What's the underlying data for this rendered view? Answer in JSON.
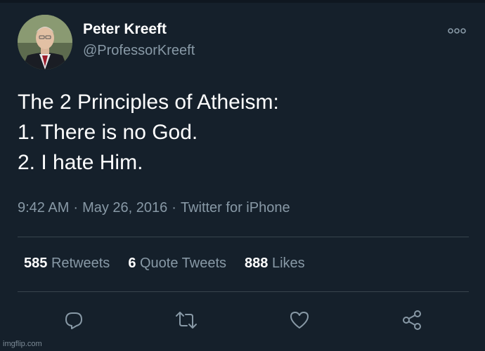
{
  "author": {
    "name": "Peter Kreeft",
    "handle": "@ProfessorKreeft"
  },
  "tweet": {
    "lines": [
      "The 2 Principles of Atheism:",
      "1. There is no God.",
      "2. I hate Him."
    ]
  },
  "meta": {
    "time": "9:42 AM",
    "separator": "·",
    "date": "May 26, 2016",
    "source": "Twitter for iPhone"
  },
  "stats": {
    "retweets_count": "585",
    "retweets_label": "Retweets",
    "quotes_count": "6",
    "quotes_label": "Quote Tweets",
    "likes_count": "888",
    "likes_label": "Likes"
  },
  "actions": [
    "reply-icon",
    "retweet-icon",
    "like-icon",
    "share-icon"
  ],
  "watermark": "imgflip.com",
  "colors": {
    "background": "#15202b",
    "text": "#ffffff",
    "secondary": "#8899a6",
    "divider": "#38444d"
  }
}
